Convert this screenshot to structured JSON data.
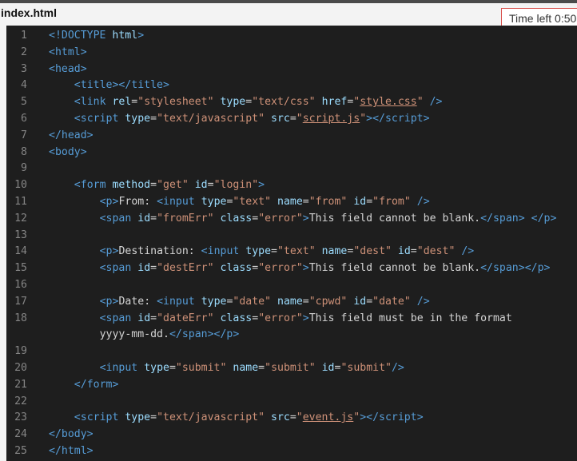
{
  "window": {
    "file_title": "index.html",
    "timer_text": "Time left 0:50"
  },
  "code_lines": [
    {
      "no": "1",
      "indent": 0,
      "tokens": [
        [
          "b",
          "<!"
        ],
        [
          "g",
          "DOCTYPE"
        ],
        [
          "x",
          " "
        ],
        [
          "a",
          "html"
        ],
        [
          "b",
          ">"
        ]
      ]
    },
    {
      "no": "2",
      "indent": 0,
      "tokens": [
        [
          "b",
          "<"
        ],
        [
          "g",
          "html"
        ],
        [
          "b",
          ">"
        ]
      ]
    },
    {
      "no": "3",
      "indent": 0,
      "tokens": [
        [
          "b",
          "<"
        ],
        [
          "g",
          "head"
        ],
        [
          "b",
          ">"
        ]
      ]
    },
    {
      "no": "4",
      "indent": 4,
      "tokens": [
        [
          "b",
          "<"
        ],
        [
          "g",
          "title"
        ],
        [
          "b",
          "></"
        ],
        [
          "g",
          "title"
        ],
        [
          "b",
          ">"
        ]
      ]
    },
    {
      "no": "5",
      "indent": 4,
      "tokens": [
        [
          "b",
          "<"
        ],
        [
          "g",
          "link"
        ],
        [
          "x",
          " "
        ],
        [
          "a",
          "rel"
        ],
        [
          "x",
          "="
        ],
        [
          "s",
          "\"stylesheet\""
        ],
        [
          "x",
          " "
        ],
        [
          "a",
          "type"
        ],
        [
          "x",
          "="
        ],
        [
          "s",
          "\"text/css\""
        ],
        [
          "x",
          " "
        ],
        [
          "a",
          "href"
        ],
        [
          "x",
          "="
        ],
        [
          "s",
          "\""
        ],
        [
          "u",
          "style.css"
        ],
        [
          "s",
          "\""
        ],
        [
          "x",
          " "
        ],
        [
          "b",
          "/>"
        ]
      ]
    },
    {
      "no": "6",
      "indent": 4,
      "tokens": [
        [
          "b",
          "<"
        ],
        [
          "g",
          "script"
        ],
        [
          "x",
          " "
        ],
        [
          "a",
          "type"
        ],
        [
          "x",
          "="
        ],
        [
          "s",
          "\"text/javascript\""
        ],
        [
          "x",
          " "
        ],
        [
          "a",
          "src"
        ],
        [
          "x",
          "="
        ],
        [
          "s",
          "\""
        ],
        [
          "u",
          "script.js"
        ],
        [
          "s",
          "\""
        ],
        [
          "b",
          "></"
        ],
        [
          "g",
          "script"
        ],
        [
          "b",
          ">"
        ]
      ]
    },
    {
      "no": "7",
      "indent": 0,
      "tokens": [
        [
          "b",
          "</"
        ],
        [
          "g",
          "head"
        ],
        [
          "b",
          ">"
        ]
      ]
    },
    {
      "no": "8",
      "indent": 0,
      "tokens": [
        [
          "b",
          "<"
        ],
        [
          "g",
          "body"
        ],
        [
          "b",
          ">"
        ]
      ]
    },
    {
      "no": "9",
      "indent": 0,
      "tokens": []
    },
    {
      "no": "10",
      "indent": 4,
      "tokens": [
        [
          "b",
          "<"
        ],
        [
          "g",
          "form"
        ],
        [
          "x",
          " "
        ],
        [
          "a",
          "method"
        ],
        [
          "x",
          "="
        ],
        [
          "s",
          "\"get\""
        ],
        [
          "x",
          " "
        ],
        [
          "a",
          "id"
        ],
        [
          "x",
          "="
        ],
        [
          "s",
          "\"login\""
        ],
        [
          "b",
          ">"
        ]
      ]
    },
    {
      "no": "11",
      "indent": 8,
      "tokens": [
        [
          "b",
          "<"
        ],
        [
          "g",
          "p"
        ],
        [
          "b",
          ">"
        ],
        [
          "x",
          "From: "
        ],
        [
          "b",
          "<"
        ],
        [
          "g",
          "input"
        ],
        [
          "x",
          " "
        ],
        [
          "a",
          "type"
        ],
        [
          "x",
          "="
        ],
        [
          "s",
          "\"text\""
        ],
        [
          "x",
          " "
        ],
        [
          "a",
          "name"
        ],
        [
          "x",
          "="
        ],
        [
          "s",
          "\"from\""
        ],
        [
          "x",
          " "
        ],
        [
          "a",
          "id"
        ],
        [
          "x",
          "="
        ],
        [
          "s",
          "\"from\""
        ],
        [
          "x",
          " "
        ],
        [
          "b",
          "/>"
        ]
      ]
    },
    {
      "no": "12",
      "indent": 8,
      "tokens": [
        [
          "b",
          "<"
        ],
        [
          "g",
          "span"
        ],
        [
          "x",
          " "
        ],
        [
          "a",
          "id"
        ],
        [
          "x",
          "="
        ],
        [
          "s",
          "\"fromErr\""
        ],
        [
          "x",
          " "
        ],
        [
          "a",
          "class"
        ],
        [
          "x",
          "="
        ],
        [
          "s",
          "\"error\""
        ],
        [
          "b",
          ">"
        ],
        [
          "x",
          "This field cannot be blank."
        ],
        [
          "b",
          "</"
        ],
        [
          "g",
          "span"
        ],
        [
          "b",
          ">"
        ],
        [
          "x",
          " "
        ],
        [
          "b",
          "</"
        ],
        [
          "g",
          "p"
        ],
        [
          "b",
          ">"
        ]
      ]
    },
    {
      "no": "13",
      "indent": 0,
      "tokens": []
    },
    {
      "no": "14",
      "indent": 8,
      "tokens": [
        [
          "b",
          "<"
        ],
        [
          "g",
          "p"
        ],
        [
          "b",
          ">"
        ],
        [
          "x",
          "Destination: "
        ],
        [
          "b",
          "<"
        ],
        [
          "g",
          "input"
        ],
        [
          "x",
          " "
        ],
        [
          "a",
          "type"
        ],
        [
          "x",
          "="
        ],
        [
          "s",
          "\"text\""
        ],
        [
          "x",
          " "
        ],
        [
          "a",
          "name"
        ],
        [
          "x",
          "="
        ],
        [
          "s",
          "\"dest\""
        ],
        [
          "x",
          " "
        ],
        [
          "a",
          "id"
        ],
        [
          "x",
          "="
        ],
        [
          "s",
          "\"dest\""
        ],
        [
          "x",
          " "
        ],
        [
          "b",
          "/>"
        ]
      ]
    },
    {
      "no": "15",
      "indent": 8,
      "tokens": [
        [
          "b",
          "<"
        ],
        [
          "g",
          "span"
        ],
        [
          "x",
          " "
        ],
        [
          "a",
          "id"
        ],
        [
          "x",
          "="
        ],
        [
          "s",
          "\"destErr\""
        ],
        [
          "x",
          " "
        ],
        [
          "a",
          "class"
        ],
        [
          "x",
          "="
        ],
        [
          "s",
          "\"error\""
        ],
        [
          "b",
          ">"
        ],
        [
          "x",
          "This field cannot be blank."
        ],
        [
          "b",
          "</"
        ],
        [
          "g",
          "span"
        ],
        [
          "b",
          "></"
        ],
        [
          "g",
          "p"
        ],
        [
          "b",
          ">"
        ]
      ]
    },
    {
      "no": "16",
      "indent": 0,
      "tokens": []
    },
    {
      "no": "17",
      "indent": 8,
      "tokens": [
        [
          "b",
          "<"
        ],
        [
          "g",
          "p"
        ],
        [
          "b",
          ">"
        ],
        [
          "x",
          "Date: "
        ],
        [
          "b",
          "<"
        ],
        [
          "g",
          "input"
        ],
        [
          "x",
          " "
        ],
        [
          "a",
          "type"
        ],
        [
          "x",
          "="
        ],
        [
          "s",
          "\"date\""
        ],
        [
          "x",
          " "
        ],
        [
          "a",
          "name"
        ],
        [
          "x",
          "="
        ],
        [
          "s",
          "\"cpwd\""
        ],
        [
          "x",
          " "
        ],
        [
          "a",
          "id"
        ],
        [
          "x",
          "="
        ],
        [
          "s",
          "\"date\""
        ],
        [
          "x",
          " "
        ],
        [
          "b",
          "/>"
        ]
      ]
    },
    {
      "no": "18",
      "indent": 8,
      "tokens": [
        [
          "b",
          "<"
        ],
        [
          "g",
          "span"
        ],
        [
          "x",
          " "
        ],
        [
          "a",
          "id"
        ],
        [
          "x",
          "="
        ],
        [
          "s",
          "\"dateErr\""
        ],
        [
          "x",
          " "
        ],
        [
          "a",
          "class"
        ],
        [
          "x",
          "="
        ],
        [
          "s",
          "\"error\""
        ],
        [
          "b",
          ">"
        ],
        [
          "x",
          "This field must be in the format"
        ]
      ]
    },
    {
      "no": "",
      "indent": 8,
      "tokens": [
        [
          "x",
          "yyyy-mm-dd."
        ],
        [
          "b",
          "</"
        ],
        [
          "g",
          "span"
        ],
        [
          "b",
          "></"
        ],
        [
          "g",
          "p"
        ],
        [
          "b",
          ">"
        ]
      ]
    },
    {
      "no": "19",
      "indent": 0,
      "tokens": []
    },
    {
      "no": "20",
      "indent": 8,
      "tokens": [
        [
          "b",
          "<"
        ],
        [
          "g",
          "input"
        ],
        [
          "x",
          " "
        ],
        [
          "a",
          "type"
        ],
        [
          "x",
          "="
        ],
        [
          "s",
          "\"submit\""
        ],
        [
          "x",
          " "
        ],
        [
          "a",
          "name"
        ],
        [
          "x",
          "="
        ],
        [
          "s",
          "\"submit\""
        ],
        [
          "x",
          " "
        ],
        [
          "a",
          "id"
        ],
        [
          "x",
          "="
        ],
        [
          "s",
          "\"submit\""
        ],
        [
          "b",
          "/>"
        ]
      ]
    },
    {
      "no": "21",
      "indent": 4,
      "tokens": [
        [
          "b",
          "</"
        ],
        [
          "g",
          "form"
        ],
        [
          "b",
          ">"
        ]
      ]
    },
    {
      "no": "22",
      "indent": 0,
      "tokens": []
    },
    {
      "no": "23",
      "indent": 4,
      "tokens": [
        [
          "b",
          "<"
        ],
        [
          "g",
          "script"
        ],
        [
          "x",
          " "
        ],
        [
          "a",
          "type"
        ],
        [
          "x",
          "="
        ],
        [
          "s",
          "\"text/javascript\""
        ],
        [
          "x",
          " "
        ],
        [
          "a",
          "src"
        ],
        [
          "x",
          "="
        ],
        [
          "s",
          "\""
        ],
        [
          "u",
          "event.js"
        ],
        [
          "s",
          "\""
        ],
        [
          "b",
          "></"
        ],
        [
          "g",
          "script"
        ],
        [
          "b",
          ">"
        ]
      ]
    },
    {
      "no": "24",
      "indent": 0,
      "tokens": [
        [
          "b",
          "</"
        ],
        [
          "g",
          "body"
        ],
        [
          "b",
          ">"
        ]
      ]
    },
    {
      "no": "25",
      "indent": 0,
      "tokens": [
        [
          "b",
          "</"
        ],
        [
          "g",
          "html"
        ],
        [
          "b",
          ">"
        ]
      ]
    }
  ]
}
